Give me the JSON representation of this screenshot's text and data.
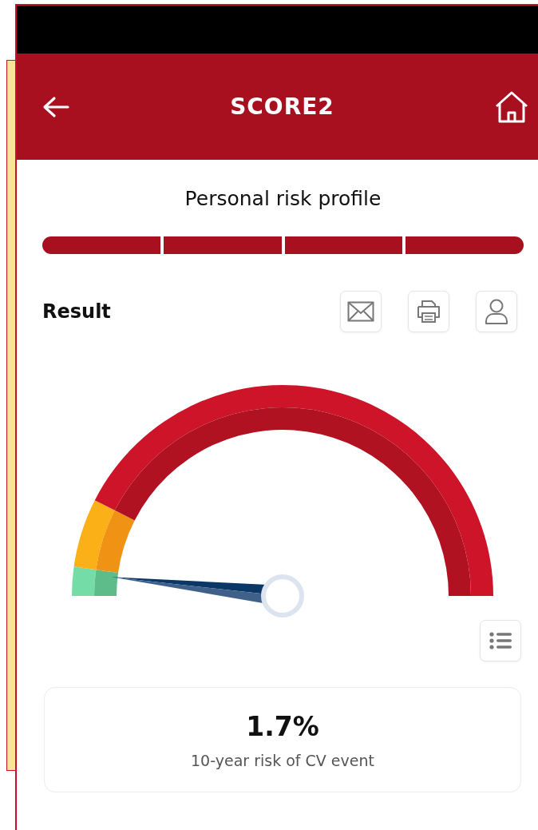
{
  "header": {
    "title": "SCORE2"
  },
  "section_title": "Personal risk profile",
  "progress_steps": [
    {
      "done": true
    },
    {
      "done": true
    },
    {
      "done": true
    },
    {
      "done": true
    }
  ],
  "result": {
    "label": "Result"
  },
  "risk": {
    "value": "1.7%",
    "caption": "10-year risk of CV event"
  }
}
